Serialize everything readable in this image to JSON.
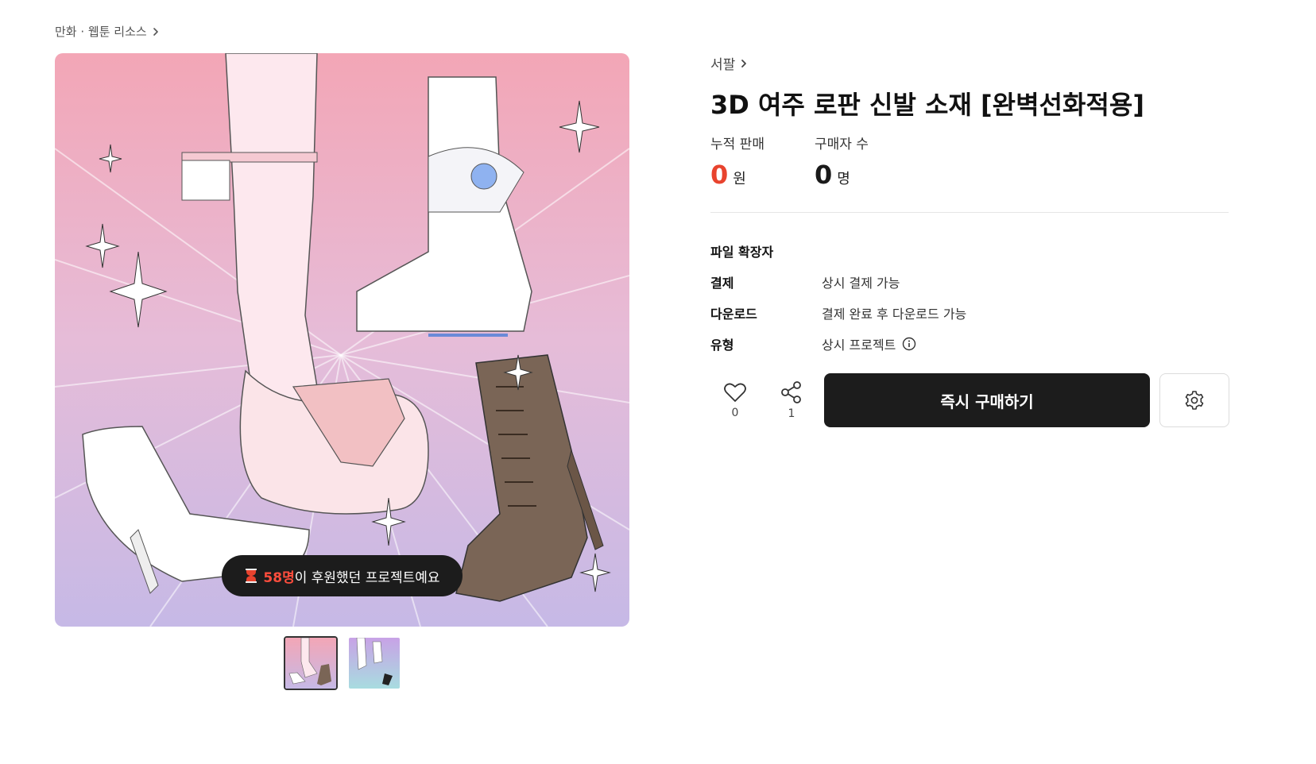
{
  "breadcrumb": {
    "label": "만화 · 웹툰 리소스"
  },
  "gallery": {
    "support_count": "58명",
    "support_text": "이 후원했던 프로젝트예요",
    "thumbnails": [
      "thumbnail-1",
      "thumbnail-2"
    ]
  },
  "product": {
    "creator": "서팔",
    "title": "3D 여주 로판 신발 소재 [완벽선화적용]",
    "stats": {
      "sales_label": "누적 판매",
      "sales_value": "0",
      "sales_unit": "원",
      "buyers_label": "구매자 수",
      "buyers_value": "0",
      "buyers_unit": "명"
    },
    "info": {
      "ext_label": "파일 확장자",
      "payment_label": "결제",
      "payment_value": "상시 결제 가능",
      "download_label": "다운로드",
      "download_value": "결제 완료 후 다운로드 가능",
      "type_label": "유형",
      "type_value": "상시 프로젝트"
    },
    "actions": {
      "like_count": "0",
      "share_count": "1",
      "buy_label": "즉시 구매하기"
    }
  },
  "colors": {
    "accent_red": "#e8432e",
    "button_dark": "#1c1c1c",
    "image_top": "#f2a7b8",
    "image_bottom": "#c8b8e6"
  }
}
